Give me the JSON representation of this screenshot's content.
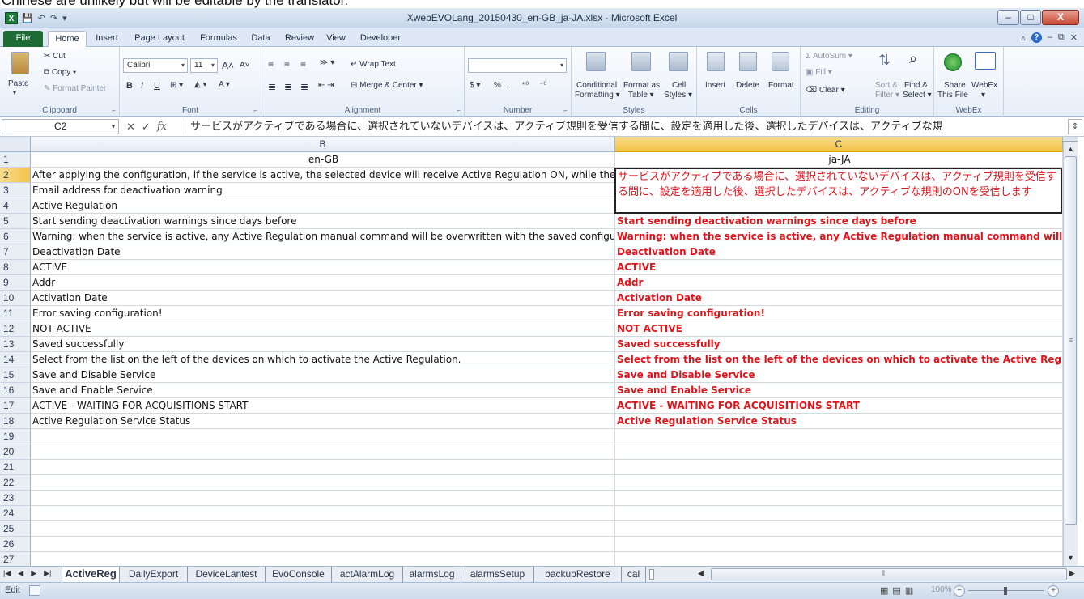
{
  "top_strip_text": "Chinese are unlikely but will be editable by the translator.",
  "window": {
    "title": "XwebEVOLang_20150430_en-GB_ja-JA.xlsx - Microsoft Excel",
    "app_icon": "X",
    "minimize": "–",
    "maximize": "□",
    "close": "X"
  },
  "qat": {
    "save": "💾",
    "undo": "↶",
    "redo": "↷",
    "customize": "▾"
  },
  "ribbon_tabs": [
    "File",
    "Home",
    "Insert",
    "Page Layout",
    "Formulas",
    "Data",
    "Review",
    "View",
    "Developer"
  ],
  "ribbon_right": {
    "help": "?",
    "minimize_ribbon": "▵",
    "min": "–",
    "restore": "⧉",
    "close": "✕"
  },
  "clipboard": {
    "paste": "Paste",
    "cut": "Cut",
    "copy": "Copy ▾",
    "format_painter": "Format Painter",
    "label": "Clipboard"
  },
  "font": {
    "name": "Calibri",
    "size": "11",
    "bold": "B",
    "italic": "I",
    "underline": "U",
    "label": "Font"
  },
  "alignment": {
    "wrap_text": "Wrap Text",
    "merge_center": "Merge & Center ▾",
    "label": "Alignment"
  },
  "number": {
    "format": "",
    "percent": "%",
    "comma": ",",
    "label": "Number"
  },
  "styles": {
    "conditional": "Conditional",
    "formatting": "Formatting ▾",
    "format_as": "Format as",
    "table": "Table ▾",
    "cell": "Cell",
    "cell_styles": "Styles ▾",
    "label": "Styles"
  },
  "cells": {
    "insert": "Insert",
    "delete": "Delete",
    "format": "Format",
    "label": "Cells"
  },
  "editing": {
    "autosum": "Σ AutoSum ▾",
    "fill": "Fill ▾",
    "clear": "Clear ▾",
    "sort": "Sort &",
    "filter": "Filter ▾",
    "find": "Find &",
    "select": "Select ▾",
    "label": "Editing"
  },
  "webex": {
    "share": "Share",
    "this_file": "This File",
    "webex": "WebEx",
    "webex_dd": "▾",
    "label": "WebEx"
  },
  "formula_bar": {
    "name_box": "C2",
    "cancel": "✕",
    "enter": "✓",
    "fx": "fx",
    "content": "サービスがアクティブである場合に、選択されていないデバイスは、アクティブ規則を受信する間に、設定を適用した後、選択したデバイスは、アクティブな規"
  },
  "columns": {
    "B": "B",
    "C": "C"
  },
  "rows": [
    {
      "n": "1",
      "b": "en-GB",
      "c": "ja-JA"
    },
    {
      "n": "2",
      "b": "After applying the configuration, if the service is active, the selected device will receive Active Regulation ON, while the devices",
      "c": "サービスがアクティブである場合に、選択されていないデバイスは、アクティブ規則を受信する間に、設定を適用した後、選択したデバイスは、アクティブな規則のONを受信します"
    },
    {
      "n": "3",
      "b": "Email address for deactivation warning",
      "c": ""
    },
    {
      "n": "4",
      "b": "Active Regulation",
      "c": ""
    },
    {
      "n": "5",
      "b": "Start sending deactivation warnings since days before",
      "c": "Start sending deactivation warnings since days before"
    },
    {
      "n": "6",
      "b": "Warning: when the service is active, any Active Regulation manual command will be overwritten with the saved configuration",
      "c": "Warning: when the service is active, any Active Regulation manual command will be overwritten"
    },
    {
      "n": "7",
      "b": "Deactivation Date",
      "c": "Deactivation Date"
    },
    {
      "n": "8",
      "b": "ACTIVE",
      "c": "ACTIVE"
    },
    {
      "n": "9",
      "b": "Addr",
      "c": "Addr"
    },
    {
      "n": "10",
      "b": "Activation Date",
      "c": "Activation Date"
    },
    {
      "n": "11",
      "b": "Error saving configuration!",
      "c": "Error saving configuration!"
    },
    {
      "n": "12",
      "b": "NOT ACTIVE",
      "c": "NOT ACTIVE"
    },
    {
      "n": "13",
      "b": "Saved successfully",
      "c": "Saved successfully"
    },
    {
      "n": "14",
      "b": "Select from the list on the left of the devices on which to activate the Active Regulation.",
      "c": "Select from the list on the left of the devices on which to activate the Active Regulation."
    },
    {
      "n": "15",
      "b": "Save and Disable Service",
      "c": "Save and Disable Service"
    },
    {
      "n": "16",
      "b": "Save and Enable Service",
      "c": "Save and Enable Service"
    },
    {
      "n": "17",
      "b": "ACTIVE - WAITING FOR ACQUISITIONS START",
      "c": "ACTIVE - WAITING FOR ACQUISITIONS START"
    },
    {
      "n": "18",
      "b": "Active Regulation Service Status",
      "c": "Active Regulation Service Status"
    },
    {
      "n": "19",
      "b": "",
      "c": ""
    },
    {
      "n": "20",
      "b": "",
      "c": ""
    },
    {
      "n": "21",
      "b": "",
      "c": ""
    },
    {
      "n": "22",
      "b": "",
      "c": ""
    },
    {
      "n": "23",
      "b": "",
      "c": ""
    },
    {
      "n": "24",
      "b": "",
      "c": ""
    },
    {
      "n": "25",
      "b": "",
      "c": ""
    },
    {
      "n": "26",
      "b": "",
      "c": ""
    },
    {
      "n": "27",
      "b": "",
      "c": ""
    }
  ],
  "sheet_tabs": [
    "ActiveReg",
    "DailyExport",
    "DeviceLantest",
    "EvoConsole",
    "actAlarmLog",
    "alarmsLog",
    "alarmsSetup",
    "backupRestore",
    "cal"
  ],
  "status": {
    "mode": "Edit",
    "zoom": "100%"
  },
  "colors": {
    "text_red": "#e0151b",
    "excel_green": "#1f6b36",
    "header_selected": "#f3c34a"
  }
}
